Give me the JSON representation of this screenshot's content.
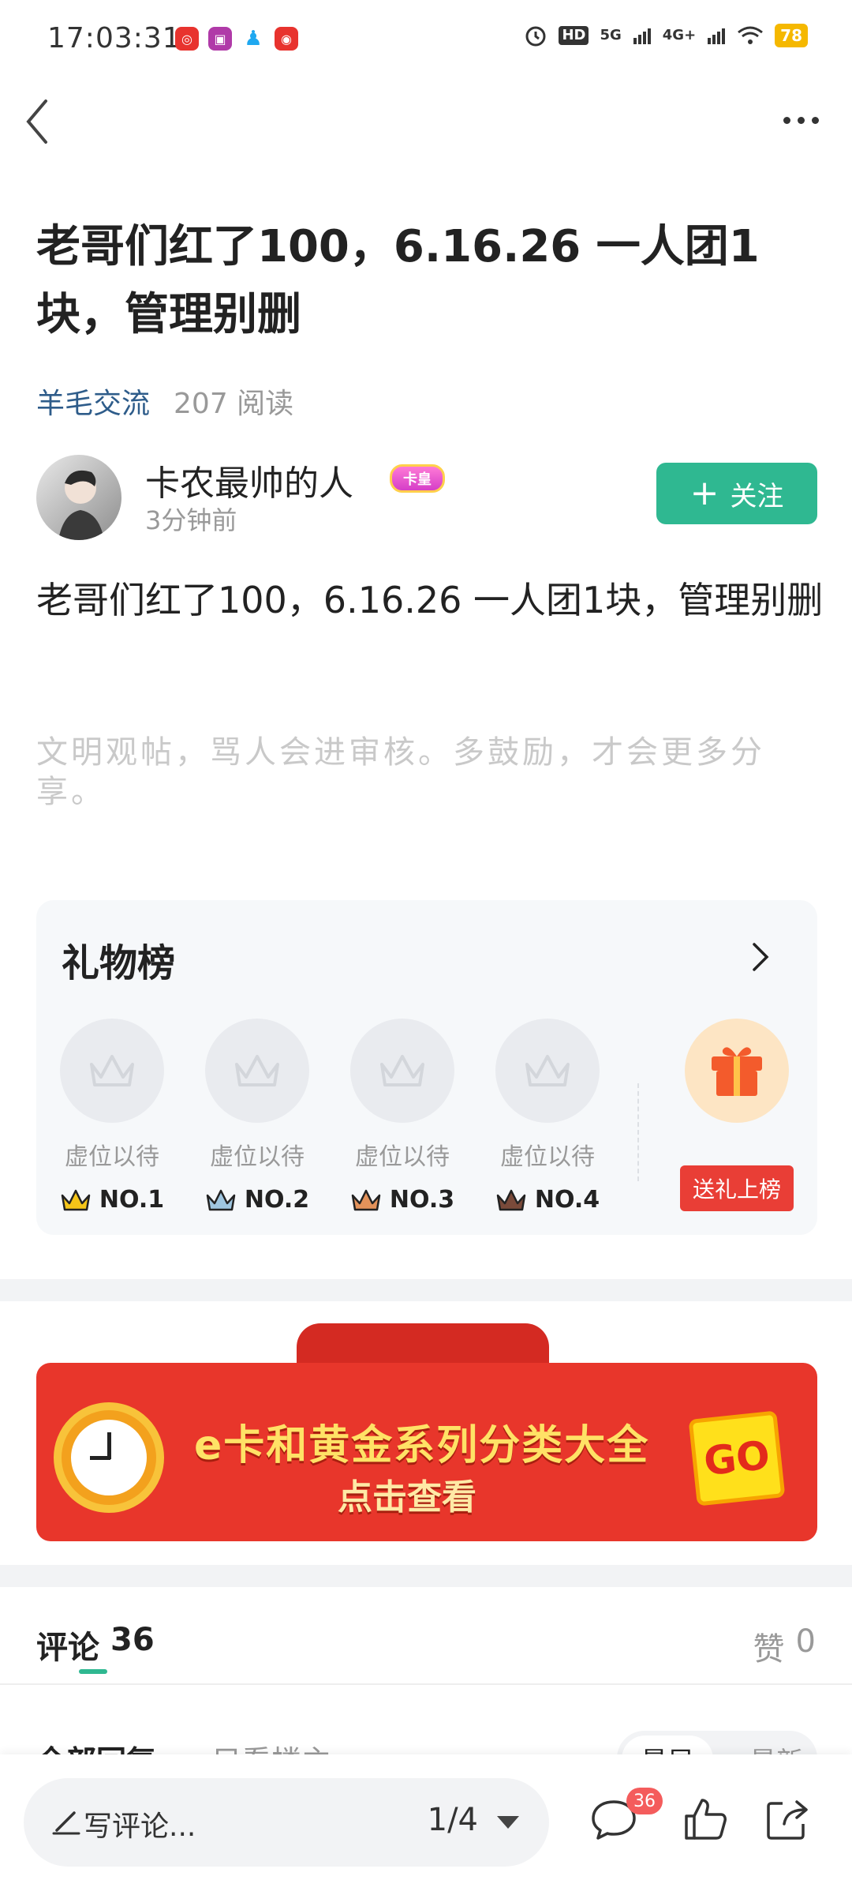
{
  "status_bar": {
    "time": "17:03:31",
    "hd_label": "HD",
    "network_5g": "5G",
    "network_4g": "4G+",
    "battery": "78"
  },
  "post": {
    "title": "老哥们红了100，6.16.26 一人团1块，管理别删",
    "category": "羊毛交流",
    "read_count": "207 阅读",
    "content": "老哥们红了100，6.16.26 一人团1块，管理别删",
    "notice": "文明观帖，骂人会进审核。多鼓励，才会更多分享。"
  },
  "author": {
    "name": "卡农最帅的人",
    "badge": "卡皇",
    "time": "3分钟前",
    "follow_label": "关注"
  },
  "gift_board": {
    "title": "礼物榜",
    "slots": [
      {
        "label": "虚位以待",
        "rank": "NO.1",
        "color": "#f5c518"
      },
      {
        "label": "虚位以待",
        "rank": "NO.2",
        "color": "#9fc6e0"
      },
      {
        "label": "虚位以待",
        "rank": "NO.3",
        "color": "#e3925a"
      },
      {
        "label": "虚位以待",
        "rank": "NO.4",
        "color": "#7a4a3a"
      }
    ],
    "send_label": "送礼上榜"
  },
  "banner": {
    "title": "e卡和黄金系列分类大全",
    "subtitle": "点击查看",
    "go": "GO"
  },
  "comments": {
    "label": "评论",
    "count": "36",
    "likes_label": "赞",
    "likes_count": "0",
    "filter_all": "全部回复",
    "filter_owner": "只看楼主",
    "sort_earliest": "最早",
    "sort_latest": "最新"
  },
  "bottom_bar": {
    "placeholder": "写评论...",
    "page": "1/4",
    "comment_badge": "36"
  },
  "colors": {
    "accent": "#2fb891",
    "category": "#2e5c8a",
    "red": "#e93e36"
  }
}
